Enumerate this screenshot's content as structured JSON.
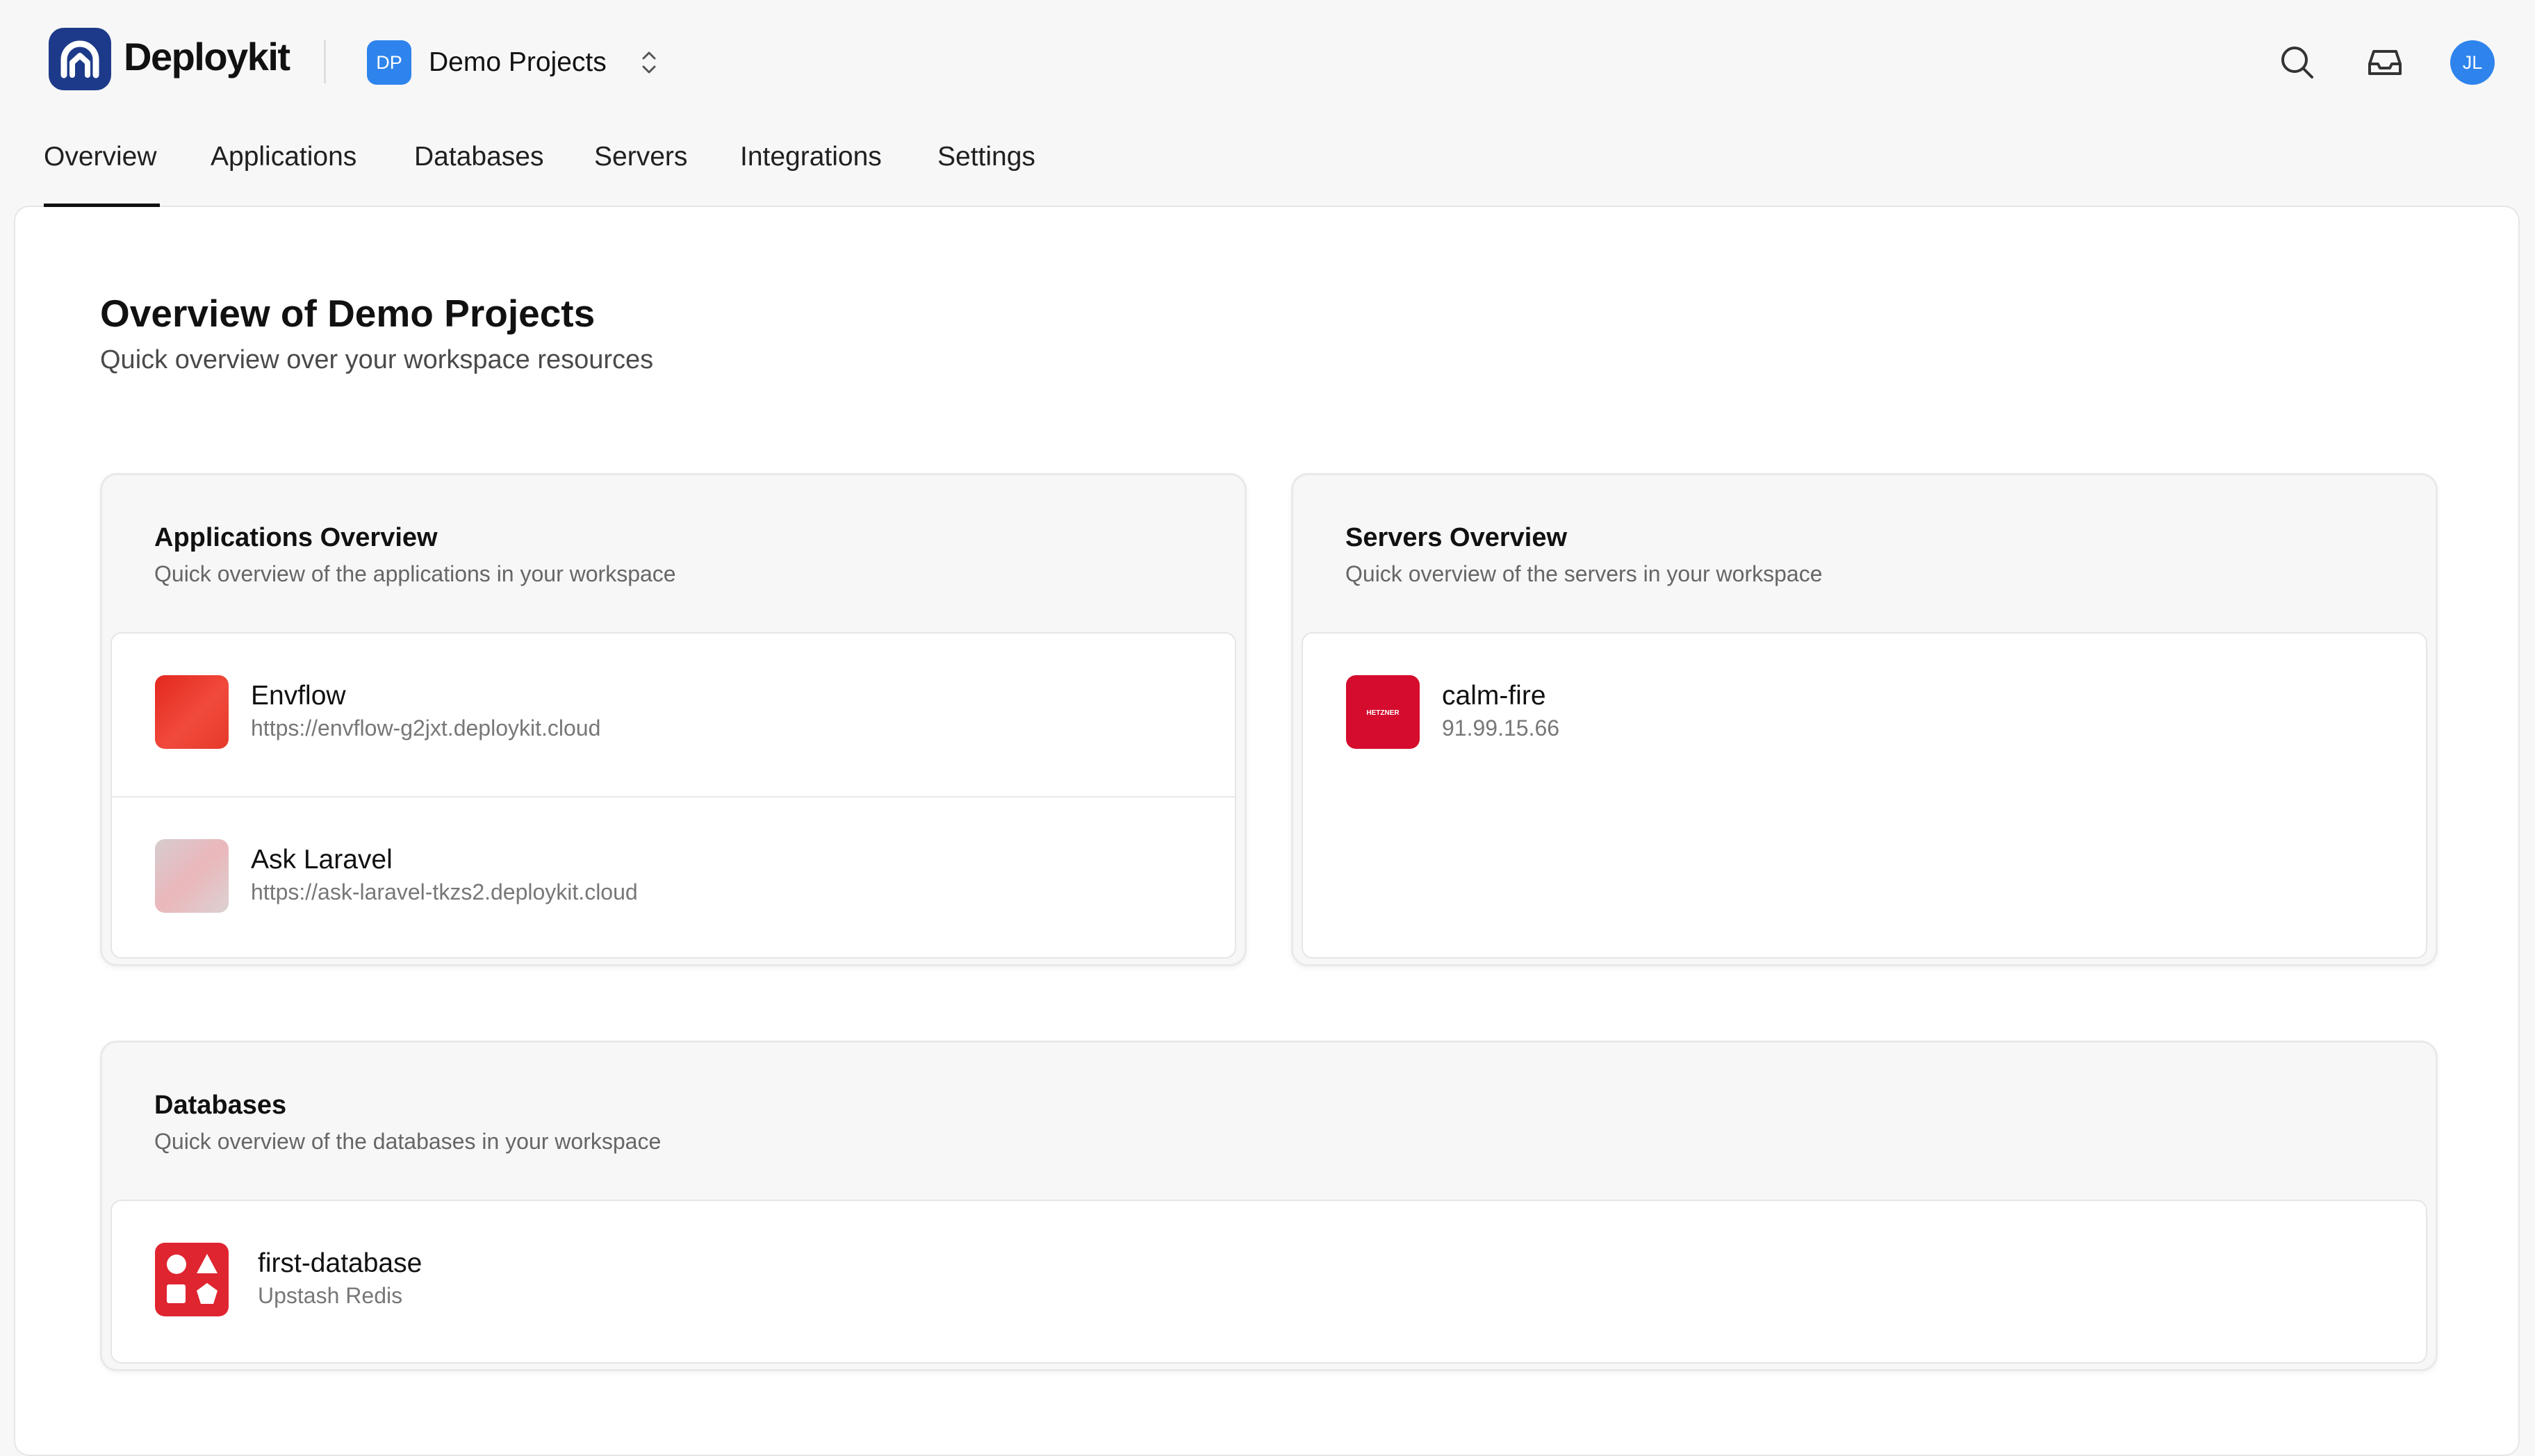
{
  "brand": {
    "name": "Deploykit"
  },
  "workspace": {
    "initials": "DP",
    "name": "Demo Projects"
  },
  "header": {
    "avatar_initials": "JL"
  },
  "tabs": [
    {
      "label": "Overview",
      "active": true
    },
    {
      "label": "Applications",
      "active": false
    },
    {
      "label": "Databases",
      "active": false
    },
    {
      "label": "Servers",
      "active": false
    },
    {
      "label": "Integrations",
      "active": false
    },
    {
      "label": "Settings",
      "active": false
    }
  ],
  "page": {
    "title": "Overview of Demo Projects",
    "subtitle": "Quick overview over your workspace resources"
  },
  "applications": {
    "title": "Applications Overview",
    "subtitle": "Quick overview of the applications in your workspace",
    "items": [
      {
        "name": "Envflow",
        "url": "https://envflow-g2jxt.deploykit.cloud"
      },
      {
        "name": "Ask Laravel",
        "url": "https://ask-laravel-tkzs2.deploykit.cloud"
      }
    ]
  },
  "servers": {
    "title": "Servers Overview",
    "subtitle": "Quick overview of the servers in your workspace",
    "items": [
      {
        "name": "calm-fire",
        "ip": "91.99.15.66",
        "provider_logo_text": "HETZNER"
      }
    ]
  },
  "databases": {
    "title": "Databases",
    "subtitle": "Quick overview of the databases in your workspace",
    "items": [
      {
        "name": "first-database",
        "type": "Upstash Redis"
      }
    ]
  },
  "colors": {
    "accent_blue": "#2e84ec",
    "brand_navy": "#1d3a8a",
    "hetzner_red": "#d50c2d",
    "upstash_red": "#df2530",
    "envflow_red": "#e8352a"
  }
}
